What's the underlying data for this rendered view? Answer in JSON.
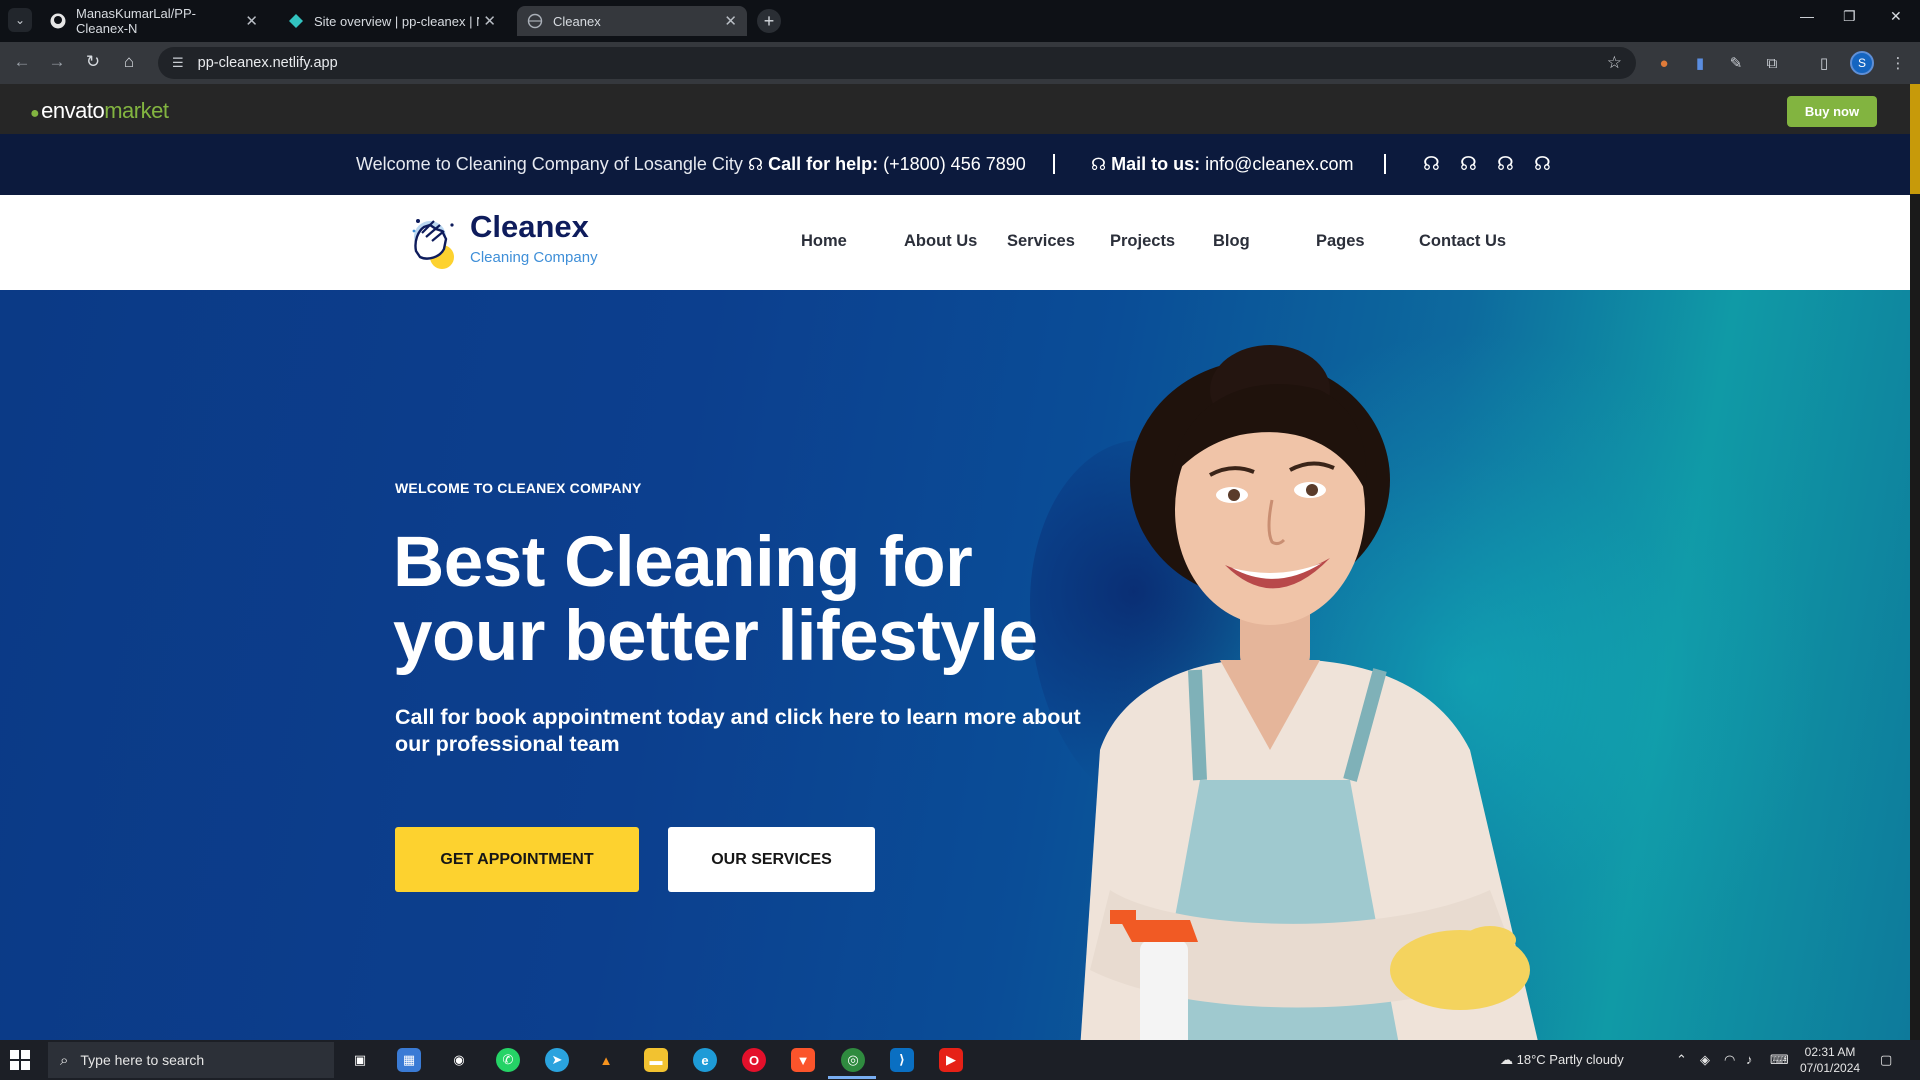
{
  "browser": {
    "tabs": [
      {
        "title": "ManasKumarLal/PP-Cleanex-N"
      },
      {
        "title": "Site overview | pp-cleanex | Net"
      },
      {
        "title": "Cleanex"
      }
    ],
    "url": "pp-cleanex.netlify.app"
  },
  "envato": {
    "logo_word": "envato",
    "logo_market": "market",
    "buy_label": "Buy now"
  },
  "topbar": {
    "welcome": "Welcome to Cleaning Company of Losangle City",
    "call_label": "Call for help:",
    "call_number": "(+1800) 456 7890",
    "mail_label": "Mail to us:",
    "mail_address": "info@cleanex.com"
  },
  "header": {
    "brand_name": "Cleanex",
    "brand_tagline": "Cleaning Company",
    "nav": [
      "Home",
      "About Us",
      "Services",
      "Projects",
      "Blog",
      "Pages",
      "Contact Us"
    ]
  },
  "hero": {
    "eyebrow": "WELCOME TO CLEANEX COMPANY",
    "headline": "Best Cleaning for your better lifestyle",
    "subline": "Call for book appointment today and click here to learn more about our professional team",
    "primary_cta": "GET APPOINTMENT",
    "secondary_cta": "OUR SERVICES"
  },
  "taskbar": {
    "search_placeholder": "Type here to search",
    "weather": "18°C  Partly cloudy",
    "time": "02:31 AM",
    "date": "07/01/2024"
  },
  "colors": {
    "accent_yellow": "#fdd22f",
    "envato_green": "#82b440",
    "brand_navy": "#0e1c5c",
    "topbar_bg": "#0c1a3d",
    "hero_blue": "#0c3f8e"
  }
}
